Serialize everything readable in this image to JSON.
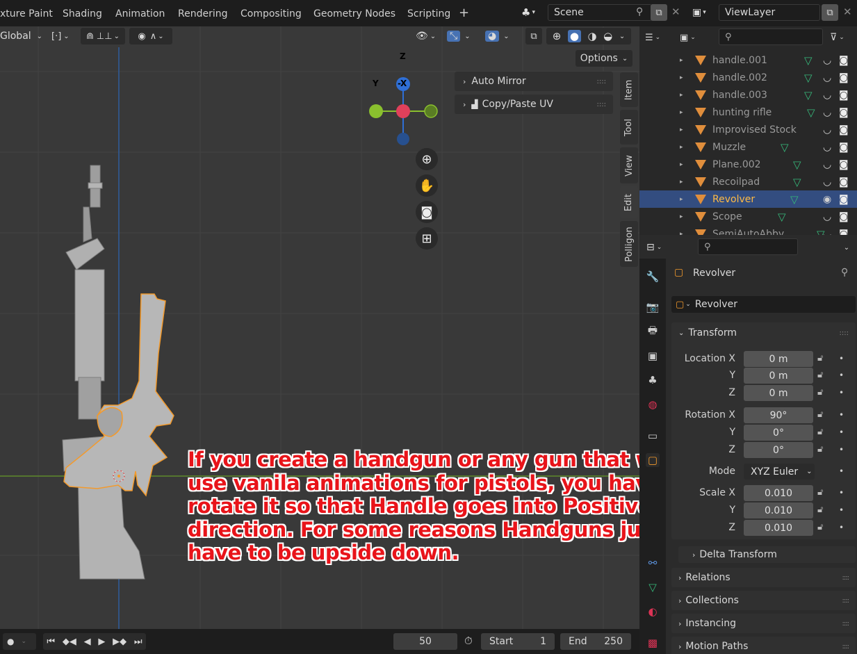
{
  "topbar": {
    "tabs": [
      "xture Paint",
      "Shading",
      "Animation",
      "Rendering",
      "Compositing",
      "Geometry Nodes",
      "Scripting",
      "+"
    ],
    "scene": "Scene",
    "view_layer": "ViewLayer"
  },
  "viewport": {
    "orientation": "Global",
    "options_label": "Options",
    "panels": [
      "Auto Mirror",
      "Copy/Paste UV"
    ],
    "side_tabs": [
      "Item",
      "Tool",
      "View",
      "Edit",
      "Polligon"
    ],
    "gizmo": {
      "z": "Z",
      "y": "Y",
      "x": "-X"
    },
    "annotation": "If you create a handgun or any gun that will use vanila animations for pistols, you have to rotate it so that Handle goes into Positive Y direction. For some reasons Handguns just have to be upside down."
  },
  "timeline": {
    "current_frame": "50",
    "start_label": "Start",
    "start": "1",
    "end_label": "End",
    "end": "250"
  },
  "outliner": {
    "items": [
      {
        "name": "handle.001",
        "selected": false
      },
      {
        "name": "handle.002",
        "selected": false
      },
      {
        "name": "handle.003",
        "selected": false
      },
      {
        "name": "hunting rifle",
        "selected": false
      },
      {
        "name": "Improvised Stock",
        "selected": false
      },
      {
        "name": "Muzzle",
        "selected": false
      },
      {
        "name": "Plane.002",
        "selected": false
      },
      {
        "name": "Recoilpad",
        "selected": false
      },
      {
        "name": "Revolver",
        "selected": true
      },
      {
        "name": "Scope",
        "selected": false
      },
      {
        "name": "SemiAutoAbby",
        "selected": false
      }
    ]
  },
  "properties": {
    "object_name": "Revolver",
    "object_field": "Revolver",
    "transform_label": "Transform",
    "location": {
      "label": "Location X",
      "x": "0 m",
      "y": "0 m",
      "z": "0 m"
    },
    "rotation": {
      "label": "Rotation X",
      "x": "90°",
      "y": "0°",
      "z": "0°"
    },
    "mode_label": "Mode",
    "mode": "XYZ Euler",
    "scale": {
      "label": "Scale X",
      "x": "0.010",
      "y": "0.010",
      "z": "0.010"
    },
    "axis_y": "Y",
    "axis_z": "Z",
    "sections": [
      "Delta Transform",
      "Relations",
      "Collections",
      "Instancing",
      "Motion Paths"
    ]
  }
}
